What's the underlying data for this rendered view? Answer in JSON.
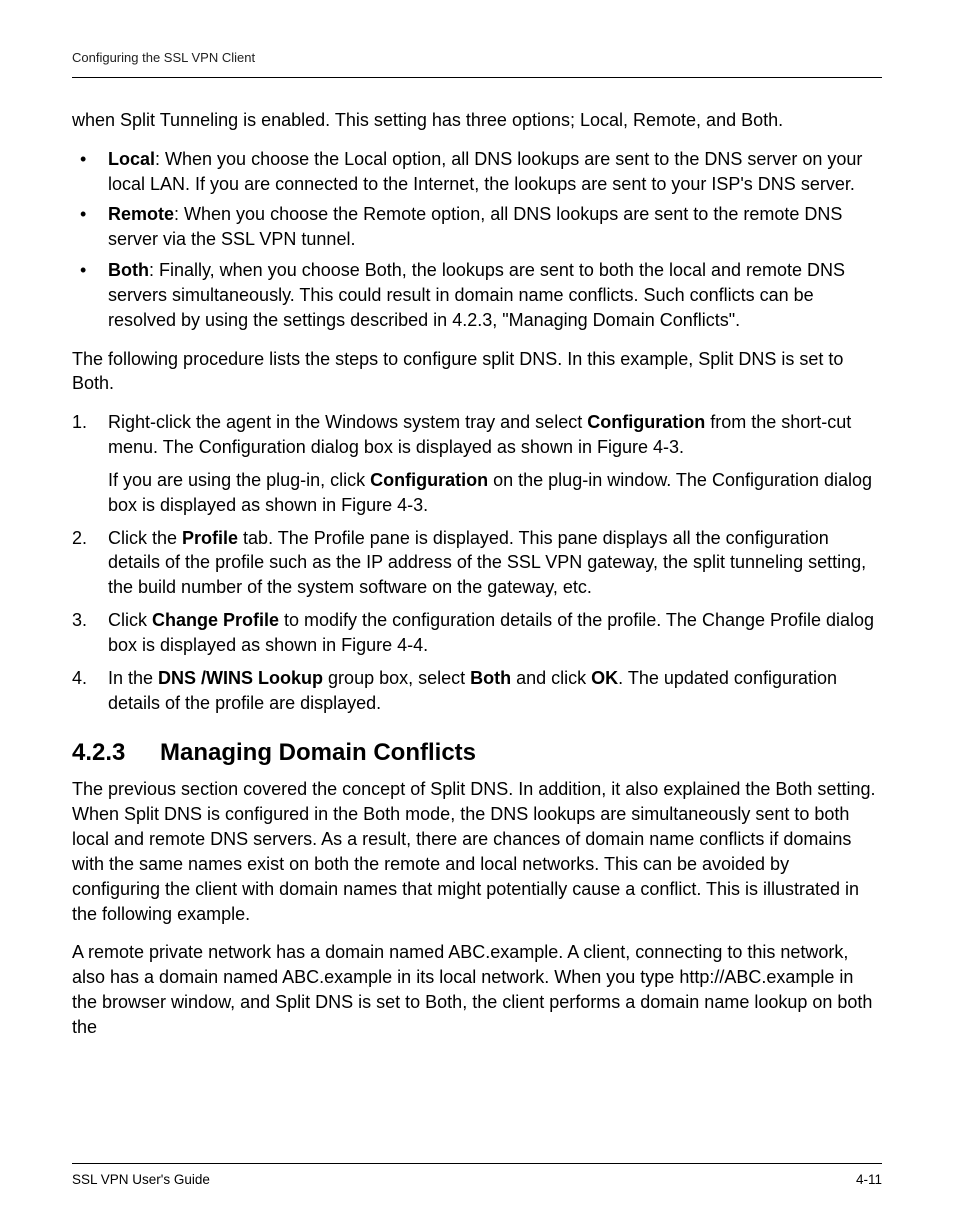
{
  "header": {
    "running_head": "Configuring the SSL VPN Client"
  },
  "intro_para": "when Split Tunneling is enabled. This setting has three options; Local, Remote, and Both.",
  "bullets": [
    {
      "term": "Local",
      "rest": ": When you choose the Local option, all DNS lookups are sent to the DNS server on your local LAN. If you are connected to the Internet, the lookups are sent to your ISP's DNS server."
    },
    {
      "term": "Remote",
      "rest": ": When you choose the Remote option, all DNS lookups are sent to the remote DNS server via the SSL VPN tunnel."
    },
    {
      "term": "Both",
      "rest": ": Finally, when you choose Both, the lookups are sent to both the local and remote DNS servers simultaneously. This could result in domain name conflicts. Such conflicts can be resolved by using the settings described in 4.2.3, \"Managing Domain Conflicts\"."
    }
  ],
  "after_bullets": "The following procedure lists the steps to configure split DNS. In this example, Split DNS is set to Both.",
  "steps": {
    "s1_a": "Right-click the agent in the Windows system tray and select ",
    "s1_b": "Configuration",
    "s1_c": " from the short-cut menu. The Configuration dialog box is displayed as shown in Figure 4-3.",
    "s1_sub_a": "If you are using the plug-in, click ",
    "s1_sub_b": "Configuration",
    "s1_sub_c": " on the plug-in window. The Configuration dialog box is displayed as shown in Figure 4-3.",
    "s2_a": "Click the ",
    "s2_b": "Profile",
    "s2_c": " tab. The Profile pane is displayed. This pane displays all the configuration details of the profile such as the IP address of the SSL VPN gateway, the split tunneling setting, the build number of the system software on the gateway, etc.",
    "s3_a": "Click ",
    "s3_b": "Change Profile",
    "s3_c": " to modify the configuration details of the profile. The Change Profile dialog box is displayed as shown in Figure 4-4.",
    "s4_a": "In the ",
    "s4_b": "DNS /WINS Lookup",
    "s4_c": " group box, select ",
    "s4_d": "Both",
    "s4_e": " and click ",
    "s4_f": "OK",
    "s4_g": ". The updated configuration details of the profile are displayed."
  },
  "section": {
    "number": "4.2.3",
    "title": "Managing Domain Conflicts",
    "para1": "The previous section covered the concept of Split DNS. In addition, it also explained the Both setting. When Split DNS is configured in the Both mode, the DNS lookups are simultaneously sent to both local and remote DNS servers. As a result, there are chances of domain name conflicts if domains with the same names exist on both the remote and local networks. This can be avoided by configuring the client with domain names that might potentially cause a conflict. This is illustrated in the following example.",
    "para2": "A remote private network has a domain named ABC.example. A client, connecting to this network, also has a domain named ABC.example in its local network. When you type http://ABC.example in the browser window, and Split DNS is set to Both, the client performs a domain name lookup on both the"
  },
  "footer": {
    "left": "SSL VPN User's Guide",
    "right": "4-11"
  }
}
